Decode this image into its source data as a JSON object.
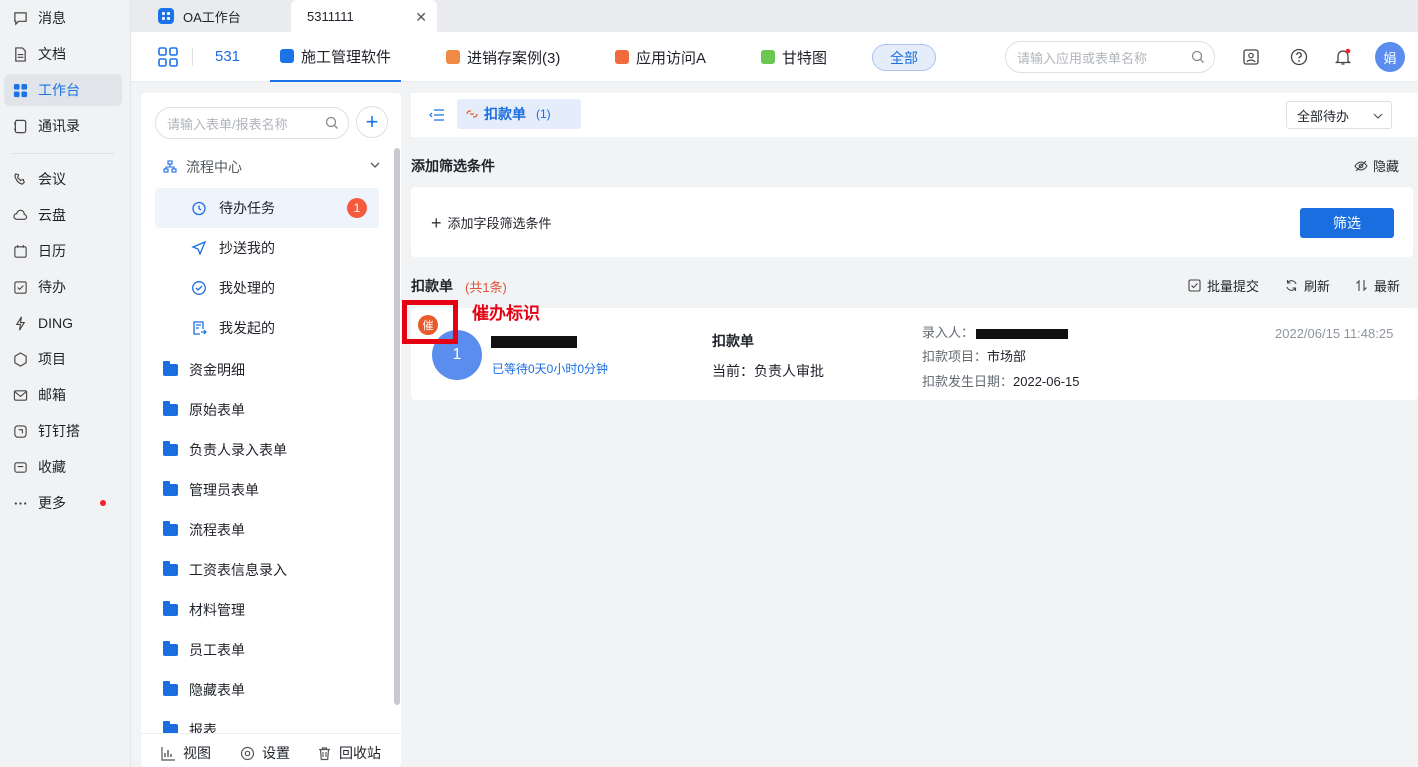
{
  "rail": {
    "items": [
      {
        "label": "消息",
        "icon": "message-icon"
      },
      {
        "label": "文档",
        "icon": "document-icon"
      },
      {
        "label": "工作台",
        "icon": "workbench-icon"
      },
      {
        "label": "通讯录",
        "icon": "contacts-icon"
      },
      {
        "label": "会议",
        "icon": "meeting-icon"
      },
      {
        "label": "云盘",
        "icon": "cloud-icon"
      },
      {
        "label": "日历",
        "icon": "calendar-icon"
      },
      {
        "label": "待办",
        "icon": "todo-icon"
      },
      {
        "label": "DING",
        "icon": "ding-icon"
      },
      {
        "label": "项目",
        "icon": "project-icon"
      },
      {
        "label": "邮箱",
        "icon": "mail-icon"
      },
      {
        "label": "钉钉搭",
        "icon": "builder-icon"
      },
      {
        "label": "收藏",
        "icon": "favorite-icon"
      },
      {
        "label": "更多",
        "icon": "more-icon"
      }
    ],
    "active_index": 2
  },
  "browser_tabs": [
    {
      "label": "OA工作台"
    },
    {
      "label": "5311111",
      "close": "✕"
    }
  ],
  "app_header": {
    "app_name": "531",
    "tabs": [
      {
        "label": "施工管理软件",
        "color": "#1a73e8"
      },
      {
        "label": "进销存案例(3)",
        "color": "#f08a45"
      },
      {
        "label": "应用访问A",
        "color": "#f06a3c"
      },
      {
        "label": "甘特图",
        "color": "#6ac752"
      }
    ],
    "all_label": "全部",
    "search_placeholder": "请输入应用或表单名称",
    "avatar_text": "娟"
  },
  "sidebar": {
    "search_placeholder": "请输入表单/报表名称",
    "add_label": "+",
    "group_label": "流程中心",
    "process_items": [
      {
        "label": "待办任务",
        "icon": "clock-icon",
        "badge": "1"
      },
      {
        "label": "抄送我的",
        "icon": "send-icon"
      },
      {
        "label": "我处理的",
        "icon": "check-circle-icon"
      },
      {
        "label": "我发起的",
        "icon": "initiated-icon"
      }
    ],
    "folders": [
      "资金明细",
      "原始表单",
      "负责人录入表单",
      "管理员表单",
      "流程表单",
      "工资表信息录入",
      "材料管理",
      "员工表单",
      "隐藏表单",
      "报表"
    ],
    "bottom": {
      "view": "视图",
      "settings": "设置",
      "recycle": "回收站"
    }
  },
  "main": {
    "form_tab": {
      "label": "扣款单",
      "count": "(1)"
    },
    "pending_filter": "全部待办",
    "filter_title": "添加筛选条件",
    "hide_label": "隐藏",
    "add_filter_label": "添加字段筛选条件",
    "filter_button": "筛选",
    "list_title": "扣款单",
    "list_count": "(共1条)",
    "actions": {
      "batch_submit": "批量提交",
      "refresh": "刷新",
      "latest": "最新"
    },
    "card": {
      "urge_badge": "催",
      "urge_annotation": "催办标识",
      "number": "1",
      "wait_text": "已等待0天0小时0分钟",
      "title": "扣款单",
      "current": "当前：负责人审批",
      "entrant_label": "录入人：",
      "project_label": "扣款项目：",
      "project_value": "市场部",
      "date_label": "扣款发生日期：",
      "date_value": "2022-06-15",
      "timestamp": "2022/06/15 11:48:25"
    }
  }
}
